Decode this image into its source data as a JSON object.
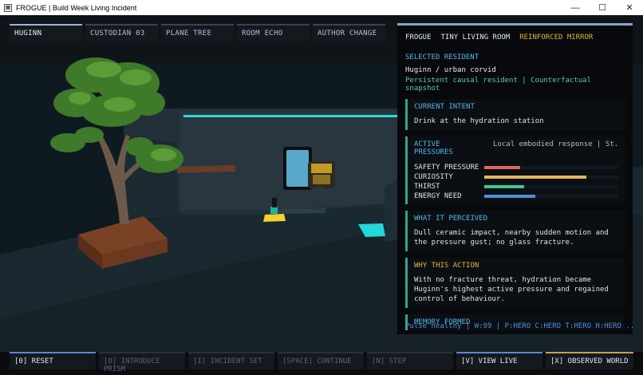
{
  "window": {
    "title": "FROGUE | Build Week Living Incident",
    "minimize_glyph": "—",
    "maximize_glyph": "☐",
    "close_glyph": "✕"
  },
  "tabs": [
    {
      "label": "HUGINN",
      "active": true
    },
    {
      "label": "CUSTODIAN 03",
      "active": false
    },
    {
      "label": "PLANE TREE",
      "active": false
    },
    {
      "label": "ROOM ECHO",
      "active": false
    },
    {
      "label": "AUTHOR CHANGE",
      "active": false
    }
  ],
  "panel": {
    "header": [
      "FROGUE",
      "TINY LIVING ROOM",
      "REINFORCED MIRROR"
    ],
    "selected_label": "SELECTED RESIDENT",
    "resident_name": "Huginn / urban corvid",
    "resident_sub": "Persistent causal resident | Counterfactual snapshot",
    "intent": {
      "title": "CURRENT INTENT",
      "body": "Drink at the hydration station"
    },
    "pressures": {
      "title": "ACTIVE PRESSURES",
      "context": "Local embodied response | St...",
      "items": [
        {
          "label": "SAFETY PRESSURE",
          "level": 0.27,
          "color": "#e06a5a"
        },
        {
          "label": "CURIOSITY",
          "level": 0.76,
          "color": "#e2b45a"
        },
        {
          "label": "THIRST",
          "level": 0.3,
          "color": "#3cc79a"
        },
        {
          "label": "ENERGY NEED",
          "level": 0.38,
          "color": "#4e8fd8"
        }
      ]
    },
    "perceived": {
      "title": "WHAT IT PERCEIVED",
      "body": "Dull ceramic impact, nearby sudden motion and the pressure gust; no glass fracture."
    },
    "why": {
      "title": "WHY THIS ACTION",
      "body": "With no fracture threat, hydration became Huginn's highest active pressure and regained control of behaviour."
    },
    "memory": {
      "title": "MEMORY FORMED"
    },
    "footer": "Pulse healthy | W:99 | P:HERO C:HERO T:HERO H:HERO ..."
  },
  "toolbar": [
    {
      "label": "[0] RESET",
      "enabled": true,
      "accent": "blue"
    },
    {
      "label": "[O] INTRODUCE PRISM",
      "enabled": false,
      "accent": "none"
    },
    {
      "label": "[I] INCIDENT SET",
      "enabled": false,
      "accent": "none"
    },
    {
      "label": "[SPACE] CONTINUE",
      "enabled": false,
      "accent": "none"
    },
    {
      "label": "[N] STEP",
      "enabled": false,
      "accent": "none"
    },
    {
      "label": "[V] VIEW LIVE",
      "enabled": true,
      "accent": "blue"
    },
    {
      "label": "[X] OBSERVED WORLD",
      "enabled": true,
      "accent": "gold"
    }
  ]
}
